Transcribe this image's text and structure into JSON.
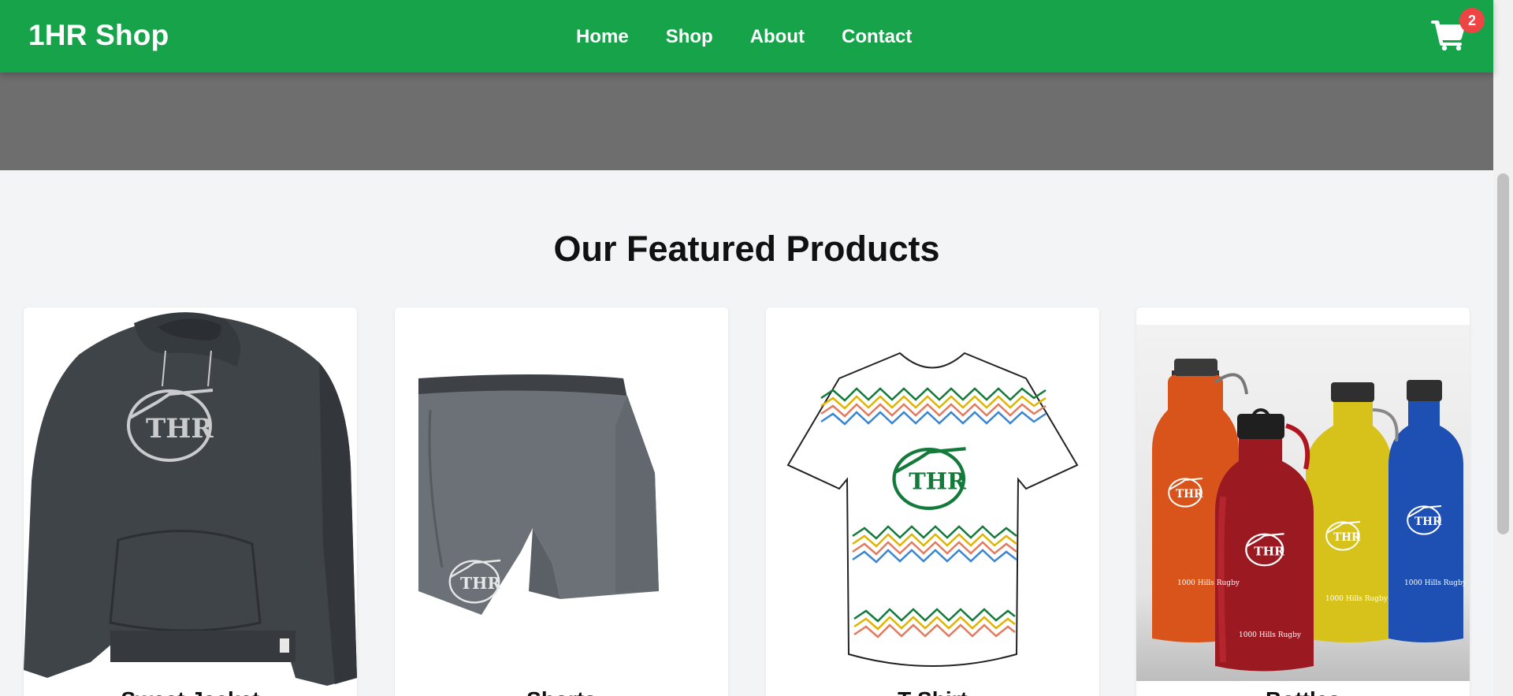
{
  "header": {
    "brand": "1HR Shop",
    "nav": [
      "Home",
      "Shop",
      "About",
      "Contact"
    ],
    "cart_count": "2"
  },
  "featured": {
    "title": "Our Featured Products",
    "products": [
      {
        "name": "Sweat Jacket",
        "image": "hoodie"
      },
      {
        "name": "Shorts",
        "image": "shorts"
      },
      {
        "name": "T-Shirt",
        "image": "tshirt"
      },
      {
        "name": "Bottles",
        "image": "bottles"
      }
    ]
  },
  "colors": {
    "header_bg": "#16a34a",
    "hero_bg": "#6e6e6e",
    "page_bg": "#f3f4f6",
    "badge_bg": "#ef4444"
  },
  "logo_text": "THR",
  "bottle_label": "1000 Hills Rugby"
}
